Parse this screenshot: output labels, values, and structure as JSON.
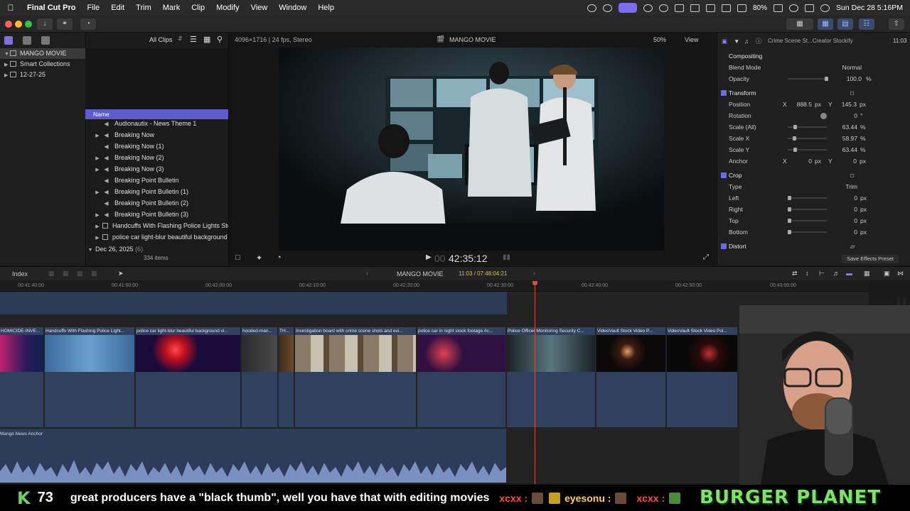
{
  "menubar": {
    "app": "Final Cut Pro",
    "items": [
      "File",
      "Edit",
      "Trim",
      "Mark",
      "Clip",
      "Modify",
      "View",
      "Window",
      "Help"
    ],
    "battery": "80%",
    "datetime": "Sun Dec 28  5:16PM"
  },
  "library": {
    "name": "MANGO MOVIE",
    "items": [
      {
        "label": "Smart Collections"
      },
      {
        "label": "12-27-25"
      }
    ]
  },
  "browser": {
    "filter": "All Clips",
    "column_header": "Name",
    "clips": [
      "Audionautix - News Theme 1",
      "Breaking Now",
      "Breaking Now (1)",
      "Breaking Now (2)",
      "Breaking Now (3)",
      "Breaking Point Bulletin",
      "Breaking Point Bulletin (1)",
      "Breaking Point Bulletin (2)",
      "Breaking Point Bulletin (3)",
      "Handcuffs With Flashing Police Lights Stock Footage",
      "police car light-blur beautiful background"
    ],
    "group_label": "Dec 26, 2025",
    "group_count": "(6)",
    "item_count": "334 items"
  },
  "viewer": {
    "format": "4096×1716 | 24 fps, Stereo",
    "project": "MANGO MOVIE",
    "zoom": "50%",
    "view_label": "View",
    "timecode_dim": "00",
    "timecode": "42:35:12"
  },
  "inspector": {
    "clip_title": "Crime Scene St...Creator Stockify",
    "duration": "11:03",
    "compositing": "Compositing",
    "blend_mode_label": "Blend Mode",
    "blend_mode": "Normal",
    "opacity_label": "Opacity",
    "opacity": "100.0",
    "opacity_unit": "%",
    "transform": "Transform",
    "position_label": "Position",
    "pos_x": "888.5",
    "pos_y": "145.3",
    "px": "px",
    "rotation_label": "Rotation",
    "rotation": "0",
    "deg": "°",
    "scale_all_label": "Scale (All)",
    "scale_all": "63.44",
    "scale_x_label": "Scale X",
    "scale_x": "58.97",
    "scale_y_label": "Scale Y",
    "scale_y": "63.44",
    "pct": "%",
    "anchor_label": "Anchor",
    "anchor_x": "0",
    "anchor_y": "0",
    "crop": "Crop",
    "type_label": "Type",
    "type": "Trim",
    "left_label": "Left",
    "right_label": "Right",
    "top_label": "Top",
    "bottom_label": "Bottom",
    "zero": "0",
    "distort": "Distort",
    "save_preset": "Save Effects Preset",
    "x_label": "X",
    "y_label": "Y"
  },
  "timeline": {
    "index_label": "Index",
    "project": "MANGO MOVIE",
    "duration": "11:03 / 07:48:04:21",
    "ruler": [
      "00:41:40:00",
      "00:41:50:00",
      "00:42:00:00",
      "00:42:10:00",
      "00:42:20:00",
      "00:42:30:00",
      "00:42:40:00",
      "00:42:50:00",
      "00:43:00:00"
    ],
    "clips": [
      "HOMICIDE-INVE...",
      "Handcuffs With Flashing Police Light...",
      "police car light-blur beautiful background vi...",
      "hooded-man...",
      "TH...",
      "Investigation board with crime scene shots and evi...",
      "police  car in night stock footage #c...",
      "Police Officer Monitoring Security C...",
      "VideoVault Stock Video  P...",
      "VideoVault Stock Video  Pol..."
    ],
    "audio_label": "Mango News Anchor"
  },
  "stream": {
    "k_letter": "K",
    "k_number": "73",
    "message": "great producers have a \"black thumb\", well you have that with editing movies",
    "user1": "xcxx :",
    "user2": "eyesonu :",
    "user3": "xcxx :",
    "brand": "BURGER PLANET"
  },
  "colors": {
    "accent": "#5c5ccc",
    "clip_blue": "#30405f",
    "playhead": "#d05040",
    "brand_green": "#7ee26a"
  }
}
